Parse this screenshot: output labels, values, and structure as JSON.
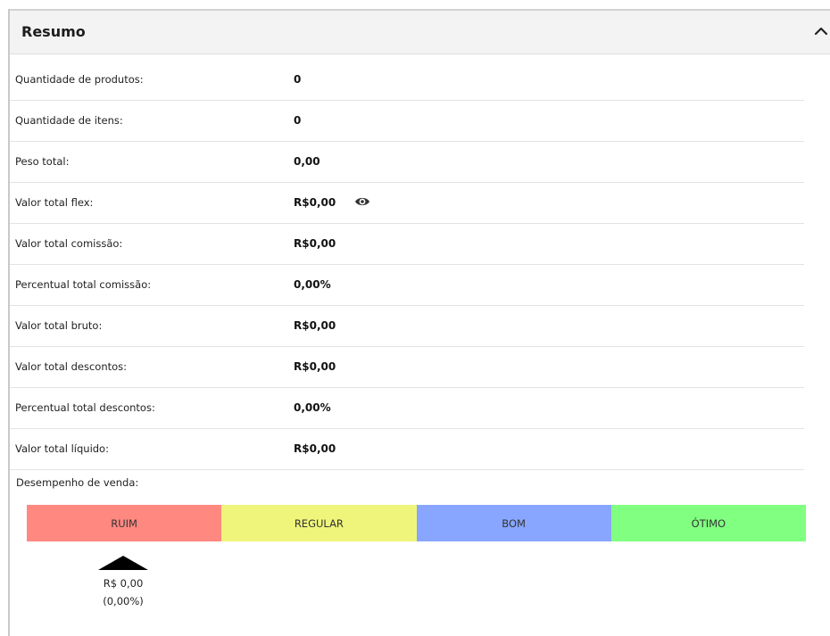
{
  "panel": {
    "title": "Resumo",
    "collapse_icon": "chevron-up-icon"
  },
  "rows": [
    {
      "label": "Quantidade de produtos:",
      "value": "0"
    },
    {
      "label": "Quantidade de itens:",
      "value": "0"
    },
    {
      "label": "Peso total:",
      "value": "0,00"
    },
    {
      "label": "Valor total flex:",
      "value": "R$0,00",
      "icon": "eye-icon"
    },
    {
      "label": "Valor total comissão:",
      "value": "R$0,00"
    },
    {
      "label": "Percentual total comissão:",
      "value": "0,00%"
    },
    {
      "label": "Valor total bruto:",
      "value": "R$0,00"
    },
    {
      "label": "Valor total descontos:",
      "value": "R$0,00"
    },
    {
      "label": "Percentual total descontos:",
      "value": "0,00%"
    },
    {
      "label": "Valor total líquido:",
      "value": "R$0,00"
    }
  ],
  "performance": {
    "label": "Desempenho de venda:",
    "segments": [
      {
        "label": "RUIM",
        "color": "#ff8880"
      },
      {
        "label": "REGULAR",
        "color": "#eff57a"
      },
      {
        "label": "BOM",
        "color": "#88a6ff"
      },
      {
        "label": "ÓTIMO",
        "color": "#80ff80"
      }
    ],
    "indicator_value": "R$ 0,00",
    "indicator_percent": "(0,00%)",
    "indicator_segment": "RUIM"
  }
}
